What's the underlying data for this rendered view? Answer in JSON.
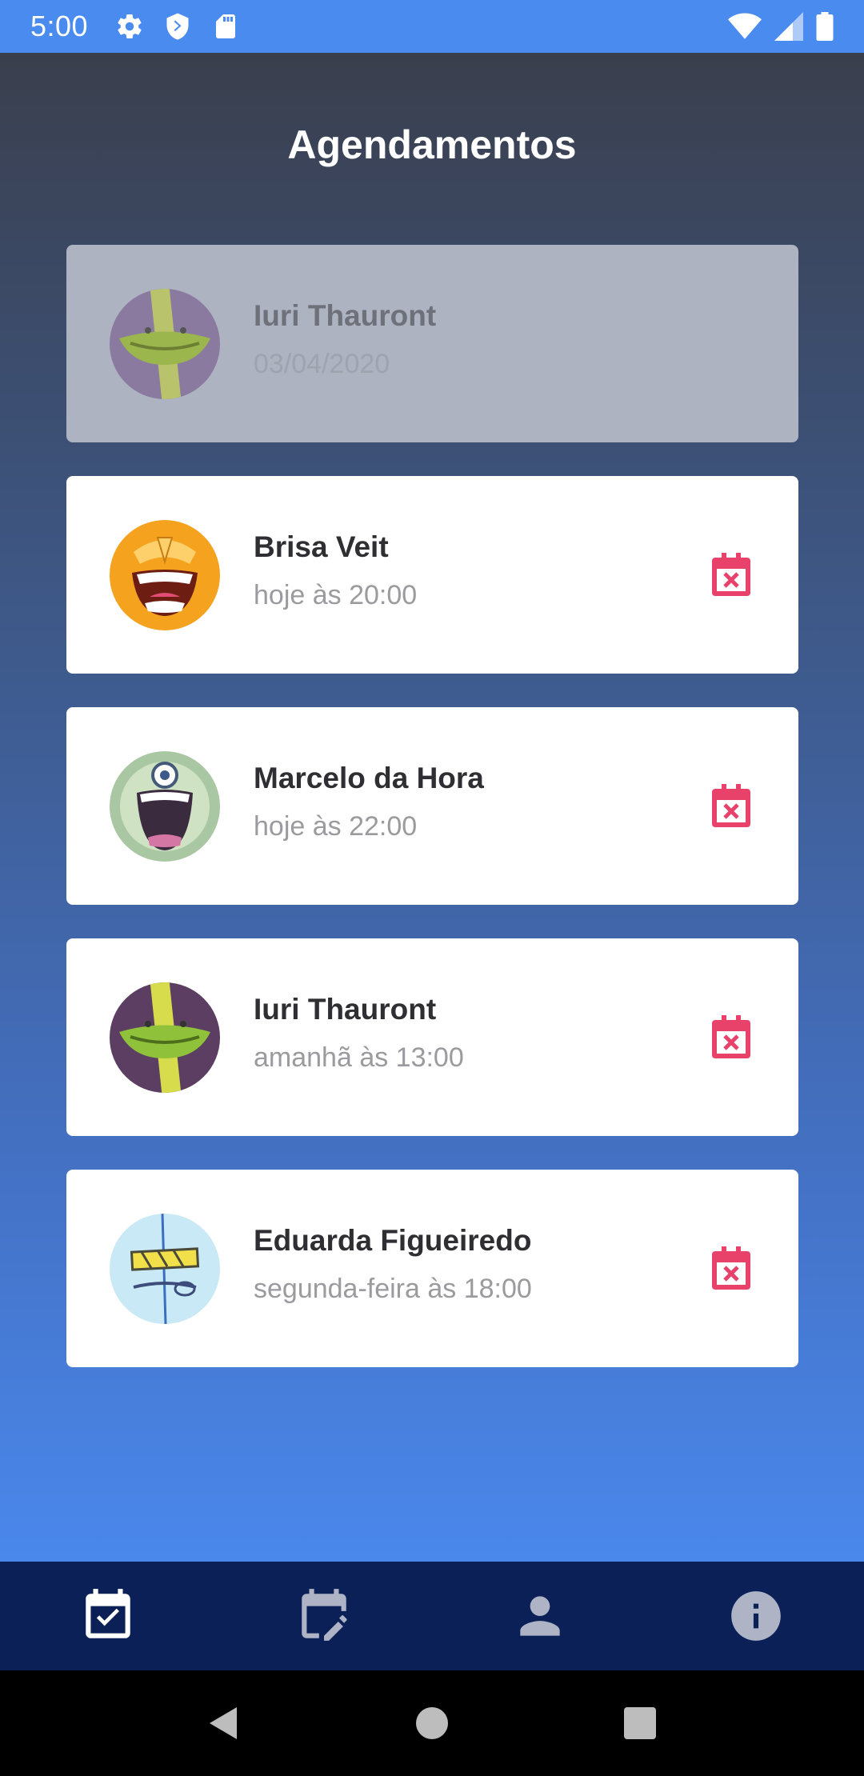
{
  "status_bar": {
    "time": "5:00",
    "left_icons": [
      "gear-icon",
      "shield-icon",
      "sd-card-icon"
    ],
    "right_icons": [
      "wifi-icon",
      "signal-icon",
      "battery-icon"
    ]
  },
  "page": {
    "title": "Agendamentos"
  },
  "appointments": [
    {
      "name": "Iuri Thauront",
      "time": "03/04/2020",
      "state": "past",
      "avatar": "cucumber-avatar"
    },
    {
      "name": "Brisa Veit",
      "time": "hoje às 20:00",
      "state": "upcoming",
      "avatar": "laughing-orange-avatar"
    },
    {
      "name": "Marcelo da Hora",
      "time": "hoje às 22:00",
      "state": "upcoming",
      "avatar": "screaming-green-avatar"
    },
    {
      "name": "Iuri Thauront",
      "time": "amanhã às 13:00",
      "state": "upcoming",
      "avatar": "cucumber-avatar"
    },
    {
      "name": "Eduarda Figueiredo",
      "time": "segunda-feira às 18:00",
      "state": "upcoming",
      "avatar": "blue-sketch-avatar"
    }
  ],
  "tabs": [
    {
      "icon": "calendar-check-icon",
      "active": true
    },
    {
      "icon": "calendar-edit-icon",
      "active": false
    },
    {
      "icon": "person-icon",
      "active": false
    },
    {
      "icon": "info-icon",
      "active": false
    }
  ],
  "colors": {
    "status_bar": "#4a8bef",
    "tab_bar": "#0c2058",
    "cancel_icon": "#e8426b",
    "active_tab": "#ffffff",
    "inactive_tab": "#aeb4c5"
  },
  "nav_bar": {
    "buttons": [
      "back-icon",
      "home-icon",
      "recents-icon"
    ]
  }
}
